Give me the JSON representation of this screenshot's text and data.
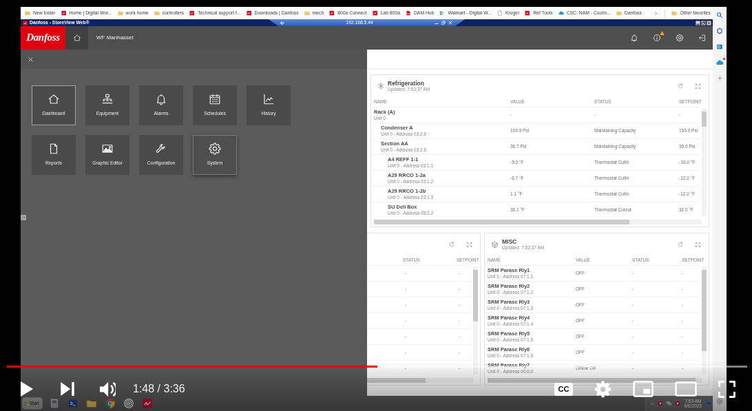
{
  "browser": {
    "bookmarks": [
      {
        "label": "New folder",
        "kind": "folder"
      },
      {
        "label": "Home | Digital Wor...",
        "kind": "danfoss"
      },
      {
        "label": "work home",
        "kind": "folder"
      },
      {
        "label": "controllers",
        "kind": "folder"
      },
      {
        "label": "Technical support f...",
        "kind": "danfoss"
      },
      {
        "label": "Downloads | Danfoss",
        "kind": "danfoss"
      },
      {
        "label": "mech",
        "kind": "folder"
      },
      {
        "label": "800a Connect",
        "kind": "danfoss"
      },
      {
        "label": "Lab 800a",
        "kind": "danfoss"
      },
      {
        "label": "DAM Hub",
        "kind": "pdf"
      },
      {
        "label": "Walmart - Digital W...",
        "kind": "walmart"
      },
      {
        "label": "Kroger",
        "kind": "page"
      },
      {
        "label": "Ref Tools",
        "kind": "danfoss"
      },
      {
        "label": "CSC: NAM - Coolin...",
        "kind": "cloud"
      },
      {
        "label": "Danfoss",
        "kind": "folder"
      }
    ],
    "other_favorites": {
      "label": "Other favorites",
      "kind": "folder"
    }
  },
  "remote_session": {
    "title": "Danfoss - StoreView Web®",
    "host": "192.168.5.44"
  },
  "header": {
    "logo": "Danfoss",
    "site": "WF Manhasset",
    "info_alert": true
  },
  "menu": {
    "tiles": [
      {
        "label": "Dashboard",
        "kind": "home",
        "selected": true,
        "hovered": false
      },
      {
        "label": "Equipment",
        "kind": "network",
        "selected": false,
        "hovered": false
      },
      {
        "label": "Alarms",
        "kind": "bell",
        "selected": false,
        "hovered": false
      },
      {
        "label": "Schedules",
        "kind": "calendar",
        "selected": false,
        "hovered": false
      },
      {
        "label": "History",
        "kind": "chart",
        "selected": false,
        "hovered": false
      },
      {
        "label": "Reports",
        "kind": "document",
        "selected": false,
        "hovered": false
      },
      {
        "label": "Graphic Editor",
        "kind": "image",
        "selected": false,
        "hovered": false
      },
      {
        "label": "Configuration",
        "kind": "wrench",
        "selected": false,
        "hovered": false
      },
      {
        "label": "System",
        "kind": "gear",
        "selected": false,
        "hovered": true
      }
    ]
  },
  "refrigeration": {
    "title": "Refrigeration",
    "updated": "Updated: 7:53:37 AM",
    "columns": [
      "NAME",
      "VALUE",
      "STATUS",
      "SETPOINT"
    ],
    "rows": [
      {
        "name": "Rack (A)",
        "address": "Unit 0",
        "value": "-",
        "status": "-",
        "setpoint": "-",
        "children": [
          {
            "name": "Condenser A",
            "address": "Unit 0 - Address 03:2.8",
            "value": "109.9 Psi",
            "status": "Maintaining Capacity",
            "setpoint": "150.0 Psi"
          },
          {
            "name": "Section AA",
            "address": "Unit 0 - Address 03:2.6",
            "value": "36.7 Psi",
            "status": "Maintaining Capacity",
            "setpoint": "35.0 Psi",
            "children": [
              {
                "name": "A4 REFF 1-1",
                "address": "Unit 0 - Address 03:1.1",
                "value": "-5.0 °F",
                "status": "Thermostat CutIn",
                "setpoint": "-10.0 °F"
              },
              {
                "name": "A29 RRCO 1-2a",
                "address": "Unit 0 - Address 03:1.2",
                "value": "-6.7 °F",
                "status": "Thermostat CutIn",
                "setpoint": "-12.0 °F"
              },
              {
                "name": "A29 RRCO 1-2b",
                "address": "Unit 0 - Address 03:1.3",
                "value": "1.1 °F",
                "status": "Thermostat CutIn",
                "setpoint": "-12.0 °F"
              },
              {
                "name": "SU Deli Box",
                "address": "Unit 0 - Address 05:2.2",
                "value": "36.1 °F",
                "status": "Thermostat Cutout",
                "setpoint": "32.0 °F"
              }
            ]
          }
        ]
      }
    ]
  },
  "partial_panel": {
    "columns": [
      "STATUS",
      "SETPOINT"
    ],
    "rows": [
      {
        "status": "-",
        "setpoint": "-"
      },
      {
        "status": "-",
        "setpoint": "-"
      },
      {
        "status": "-",
        "setpoint": "-"
      },
      {
        "status": "-",
        "setpoint": "-"
      },
      {
        "status": "-",
        "setpoint": "-"
      },
      {
        "status": "-",
        "setpoint": "-"
      },
      {
        "status": "-",
        "setpoint": "-"
      }
    ]
  },
  "misc": {
    "title": "MISC",
    "updated": "Updated: 7:53:37 AM",
    "columns": [
      "NAME",
      "VALUE",
      "STATUS",
      "SETPOINT"
    ],
    "rows": [
      {
        "name": "SRM Parase Rly1",
        "address": "Unit 0 - Address 07:1.1",
        "value": "OFF",
        "status": "-",
        "setpoint": "-"
      },
      {
        "name": "SRM Parase Rly2",
        "address": "Unit 0 - Address 07:1.2",
        "value": "OFF",
        "status": "-",
        "setpoint": "-"
      },
      {
        "name": "SRM Parase Rly3",
        "address": "Unit 0 - Address 07:1.3",
        "value": "OFF",
        "status": "-",
        "setpoint": "-"
      },
      {
        "name": "SRM Parase Rly4",
        "address": "Unit 0 - Address 07:1.4",
        "value": "OFF",
        "status": "-",
        "setpoint": "-"
      },
      {
        "name": "SRM Parase Rly5",
        "address": "Unit 0 - Address 07:1.5",
        "value": "OFF",
        "status": "-",
        "setpoint": "-"
      },
      {
        "name": "SRM Parase Rly6",
        "address": "Unit 0 - Address 07:1.6",
        "value": "OFF",
        "status": "-",
        "setpoint": "-"
      },
      {
        "name": "SRM Parase Rly7",
        "address": "Unit 0 - Address 00:0.0",
        "value": "Offline Off",
        "status": "-",
        "setpoint": "-"
      }
    ]
  },
  "player": {
    "level": 0.5,
    "time": "1:48 / 3:36",
    "captions": "CC"
  },
  "taskbar": {
    "start": "Start",
    "time": "7:53 AM",
    "date": "6/6/2023"
  }
}
